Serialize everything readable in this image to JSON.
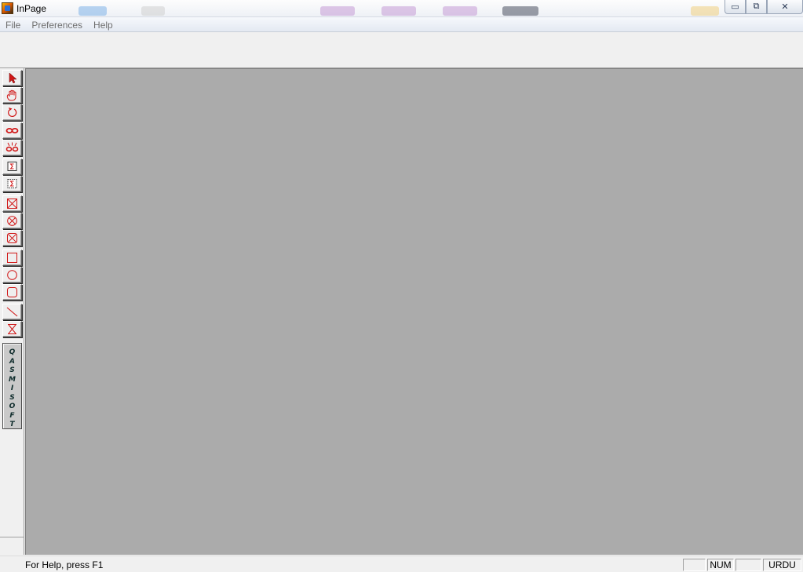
{
  "window": {
    "title": "InPage",
    "minimize_glyph": "▭",
    "restore_glyph": "⧉",
    "close_glyph": "✕"
  },
  "menu": {
    "items": [
      "File",
      "Preferences",
      "Help"
    ]
  },
  "palette": {
    "tools": [
      {
        "name": "pointer-tool",
        "icon": "arrow-pointer-icon"
      },
      {
        "name": "hand-tool",
        "icon": "hand-icon"
      },
      {
        "name": "rotate-tool",
        "icon": "rotate-icon"
      },
      {
        "name": "link-tool",
        "icon": "chain-link-icon"
      },
      {
        "name": "unlink-tool",
        "icon": "broken-link-icon"
      },
      {
        "name": "text-frame-tool",
        "icon": "text-frame-icon"
      },
      {
        "name": "text-frame-alt-tool",
        "icon": "text-frame-alt-icon"
      },
      {
        "name": "rect-picture-frame-tool",
        "icon": "rect-x-frame-icon"
      },
      {
        "name": "oval-picture-frame-tool",
        "icon": "oval-x-frame-icon"
      },
      {
        "name": "rounded-picture-frame-tool",
        "icon": "rounded-x-frame-icon"
      },
      {
        "name": "rectangle-tool",
        "icon": "rectangle-icon"
      },
      {
        "name": "oval-tool",
        "icon": "oval-icon"
      },
      {
        "name": "rounded-rectangle-tool",
        "icon": "rounded-rect-icon"
      },
      {
        "name": "line-tool",
        "icon": "diagonal-line-icon"
      },
      {
        "name": "hourglass-tool",
        "icon": "hourglass-icon"
      }
    ],
    "logo_letters": [
      "Q",
      "A",
      "S",
      "M",
      "I",
      "S",
      "O",
      "F",
      "T"
    ]
  },
  "status": {
    "help_text": "For Help, press F1",
    "pane1": "",
    "num": "NUM",
    "pane3": "",
    "lang": "URDU"
  },
  "colors": {
    "workspace": "#ababab",
    "icon_red": "#d01818"
  }
}
